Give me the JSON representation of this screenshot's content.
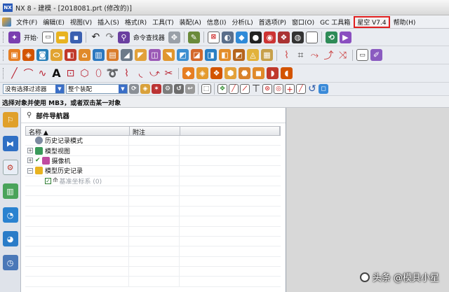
{
  "window": {
    "title": "NX 8 - 建模 - [2018081.prt (修改的)]"
  },
  "menubar": {
    "items": [
      "文件(F)",
      "编辑(E)",
      "视图(V)",
      "插入(S)",
      "格式(R)",
      "工具(T)",
      "装配(A)",
      "信息(I)",
      "分析(L)",
      "首选项(P)",
      "窗口(O)",
      "GC 工具箱"
    ],
    "highlighted": "星空 V7.4",
    "help": "帮助(H)"
  },
  "toolbar": {
    "start_label": "开始·",
    "find_command": "命令查找器"
  },
  "selection": {
    "filter_value": "没有选择过滤器",
    "scope_value": "整个装配"
  },
  "status": {
    "prompt": "选择对象并使用 MB3，或者双击某一对象"
  },
  "navigator": {
    "title": "部件导航器",
    "columns": [
      "名称 ▲",
      "附注"
    ],
    "rows": [
      {
        "label": "历史记录模式"
      },
      {
        "label": "模型视图"
      },
      {
        "label": "摄像机"
      },
      {
        "label": "模型历史记录"
      },
      {
        "label": "基准坐标系 (0)"
      }
    ]
  },
  "watermark": {
    "text": "头条 @模具小星"
  },
  "colors": {
    "highlight_border": "#e02020",
    "viewport_bg": "#d8d8d8"
  }
}
